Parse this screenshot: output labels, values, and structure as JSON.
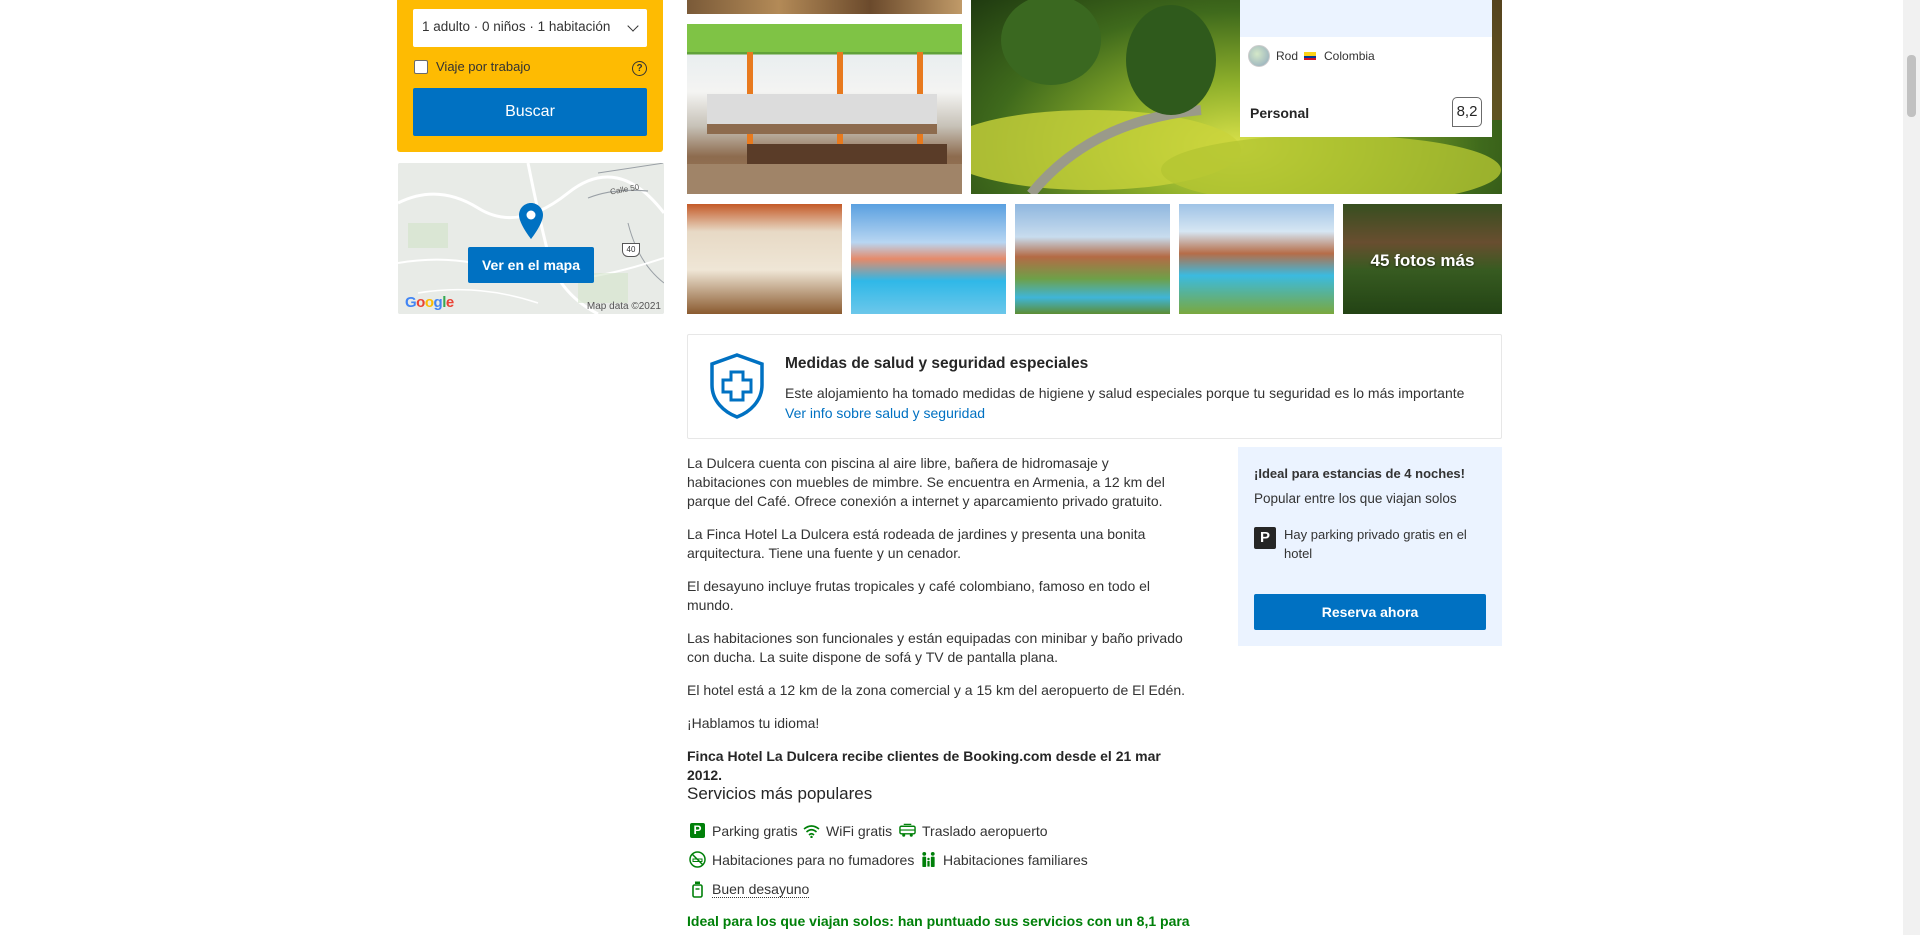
{
  "search": {
    "occupancy": "1 adulto · 0 niños · 1 habitación",
    "work_trip_label": "Viaje por trabajo",
    "help": "?",
    "search_button": "Buscar"
  },
  "map": {
    "button": "Ver en el mapa",
    "google": "Google",
    "attribution": "Map data ©2021",
    "road_label": "Calle 50",
    "road_shield": "40"
  },
  "gallery": {
    "more_photos": "45 fotos más"
  },
  "review": {
    "reviewer_name": "Rod",
    "reviewer_country": "Colombia",
    "category_label": "Personal",
    "category_score": "8,2"
  },
  "health": {
    "title": "Medidas de salud y seguridad especiales",
    "text": "Este alojamiento ha tomado medidas de higiene y salud especiales porque tu seguridad es lo más importante",
    "link": "Ver info sobre salud y seguridad"
  },
  "description": {
    "paragraphs": [
      "La Dulcera cuenta con piscina al aire libre, bañera de hidromasaje y habitaciones con muebles de mimbre. Se encuentra en Armenia, a 12 km del parque del Café. Ofrece conexión a internet y aparcamiento privado gratuito.",
      "La Finca Hotel La Dulcera está rodeada de jardines y presenta una bonita arquitectura. Tiene una fuente y un cenador.",
      "El desayuno incluye frutas tropicales y café colombiano, famoso en todo el mundo.",
      "Las habitaciones son funcionales y están equipadas con minibar y baño privado con ducha. La suite dispone de sofá y TV de pantalla plana.",
      "El hotel está a 12 km de la zona comercial y a 15 km del aeropuerto de El Edén.",
      "¡Hablamos tu idioma!"
    ],
    "since": "Finca Hotel La Dulcera recibe clientes de Booking.com desde el 21 mar 2012."
  },
  "services": {
    "title": "Servicios más populares",
    "items": [
      {
        "label": "Parking gratis",
        "icon": "parking-icon"
      },
      {
        "label": "WiFi gratis",
        "icon": "wifi-icon"
      },
      {
        "label": "Traslado aeropuerto",
        "icon": "shuttle-icon"
      },
      {
        "label": "Habitaciones para no fumadores",
        "icon": "no-smoking-icon"
      },
      {
        "label": "Habitaciones familiares",
        "icon": "family-icon"
      },
      {
        "label": "Buen desayuno",
        "icon": "coffee-icon"
      }
    ],
    "solo_note": "Ideal para los que viajan solos: han puntuado sus servicios con un 8,1 para"
  },
  "highlight": {
    "title": "¡Ideal para estancias de 4 noches!",
    "popular": "Popular entre los que viajan solos",
    "parking_badge": "P",
    "parking": "Hay parking privado gratis en el hotel",
    "reserve_button": "Reserva ahora"
  },
  "colors": {
    "brand_blue": "#0071c2",
    "search_yellow": "#febb02",
    "highlight_bg": "#ebf3ff",
    "green": "#008009"
  }
}
